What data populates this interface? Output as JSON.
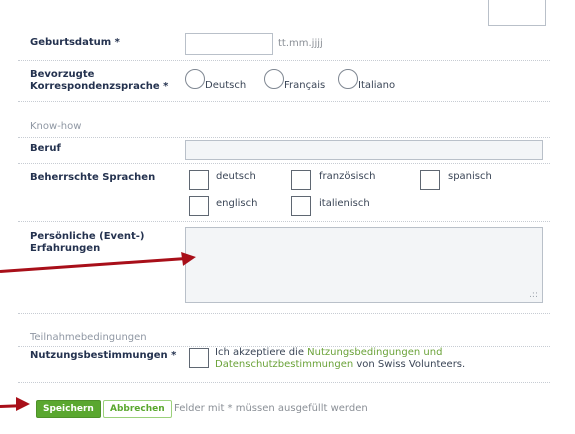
{
  "form": {
    "birthdate": {
      "label": "Geburtsdatum *",
      "placeholder_hint": "tt.mm.jjjj"
    },
    "preferred_language": {
      "label": "Bevorzugte Korrespondenzsprache *",
      "options": [
        "Deutsch",
        "Français",
        "Italiano"
      ]
    },
    "section_knowhow": "Know-how",
    "occupation": {
      "label": "Beruf"
    },
    "languages": {
      "label": "Beherrschte Sprachen",
      "options": [
        "deutsch",
        "französisch",
        "spanisch",
        "englisch",
        "italienisch"
      ]
    },
    "experiences": {
      "label": "Persönliche (Event-) Erfahrungen"
    },
    "section_conditions": "Teilnahmebedingungen",
    "terms": {
      "label": "Nutzungsbestimmungen *",
      "text_before": "Ich akzeptiere die ",
      "link1": "Nutzungsbedingungen und Datenschutzbestimmungen",
      "text_after": " von Swiss Volunteers."
    },
    "actions": {
      "save": "Speichern",
      "cancel": "Abbrechen",
      "note": "Felder mit * müssen ausgefüllt werden"
    }
  },
  "colors": {
    "accent_green": "#5aa72f",
    "arrow_red": "#a80f19"
  }
}
